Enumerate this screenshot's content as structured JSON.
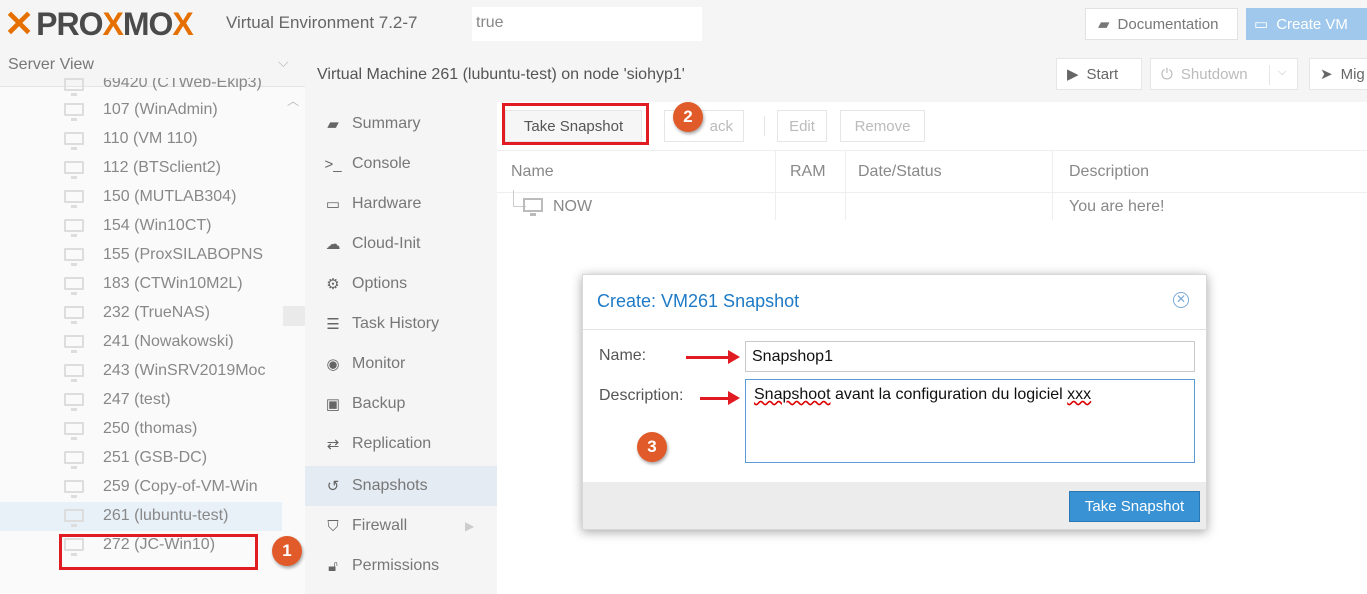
{
  "topbar": {
    "logo_text": "PROXMOX",
    "env_version": "Virtual Environment 7.2-7",
    "search_value": "true",
    "documentation_label": "Documentation",
    "create_vm_label": "Create VM"
  },
  "tree": {
    "header": "Server View",
    "items": [
      {
        "label": "69420 (CTWeb-Ekip3)"
      },
      {
        "label": "107 (WinAdmin)"
      },
      {
        "label": "110 (VM 110)"
      },
      {
        "label": "112 (BTSclient2)"
      },
      {
        "label": "150 (MUTLAB304)"
      },
      {
        "label": "154 (Win10CT)"
      },
      {
        "label": "155 (ProxSILABOPNS"
      },
      {
        "label": "183 (CTWin10M2L)"
      },
      {
        "label": "232 (TrueNAS)"
      },
      {
        "label": "241 (Nowakowski)"
      },
      {
        "label": "243 (WinSRV2019Moc"
      },
      {
        "label": "247 (test)"
      },
      {
        "label": "250 (thomas)"
      },
      {
        "label": "251 (GSB-DC)"
      },
      {
        "label": "259 (Copy-of-VM-Win"
      },
      {
        "label": "261 (lubuntu-test)"
      },
      {
        "label": "272 (JC-Win10)"
      }
    ]
  },
  "main": {
    "title": "Virtual Machine 261 (lubuntu-test) on node 'siohyp1'",
    "start_label": "Start",
    "shutdown_label": "Shutdown",
    "migrate_label": "Mig"
  },
  "menu": {
    "items": [
      {
        "label": "Summary",
        "icon": "book-icon"
      },
      {
        "label": "Console",
        "icon": "terminal-icon"
      },
      {
        "label": "Hardware",
        "icon": "monitor-icon"
      },
      {
        "label": "Cloud-Init",
        "icon": "cloud-icon"
      },
      {
        "label": "Options",
        "icon": "gear-icon"
      },
      {
        "label": "Task History",
        "icon": "list-icon"
      },
      {
        "label": "Monitor",
        "icon": "eye-icon"
      },
      {
        "label": "Backup",
        "icon": "floppy-icon"
      },
      {
        "label": "Replication",
        "icon": "retweet-icon"
      },
      {
        "label": "Snapshots",
        "icon": "history-icon"
      },
      {
        "label": "Firewall",
        "icon": "shield-icon"
      },
      {
        "label": "Permissions",
        "icon": "unlock-icon"
      }
    ]
  },
  "snapshots": {
    "toolbar": {
      "take_snapshot": "Take Snapshot",
      "rollback": "ack",
      "edit": "Edit",
      "remove": "Remove"
    },
    "columns": {
      "name": "Name",
      "ram": "RAM",
      "date_status": "Date/Status",
      "description": "Description"
    },
    "rows": [
      {
        "name": "NOW",
        "ram": "",
        "date_status": "",
        "description": "You are here!"
      }
    ]
  },
  "dialog": {
    "title": "Create: VM261 Snapshot",
    "name_label": "Name:",
    "name_value": "Snapshop1",
    "description_label": "Description:",
    "description_value": "Snapshoot avant la configuration du logiciel xxx",
    "submit_label": "Take Snapshot"
  },
  "annotations": {
    "step1": "1",
    "step2": "2",
    "step3": "3",
    "highlight_color": "#e01b22",
    "badge_color": "#e05a2a"
  }
}
